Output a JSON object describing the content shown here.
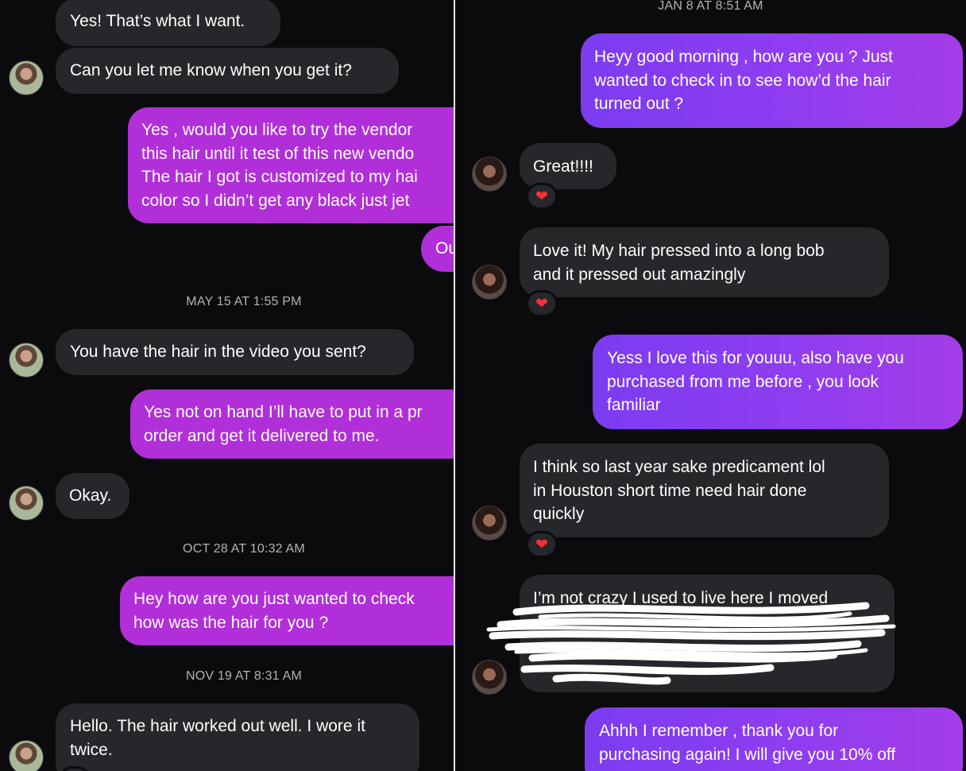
{
  "left": {
    "timestamps": [
      "MAY 15 AT 1:55 PM",
      "OCT 28 AT 10:32 AM",
      "NOV 19 AT 8:31 AM"
    ],
    "messages": [
      {
        "lines": [
          "Yes! That’s what I want."
        ]
      },
      {
        "lines": [
          "Can you let me know when you get it?"
        ]
      },
      {
        "lines": [
          "Yes , would you like to try the vendor",
          "this hair until it test of this new vendo",
          "The hair I got is customized to my hai",
          "color so I didn’t get any black just jet"
        ]
      },
      {
        "lines": [
          "Ou"
        ]
      },
      {
        "lines": [
          "You have the hair in the video you sent?"
        ]
      },
      {
        "lines": [
          "Yes not on hand I’ll have to put in a pr",
          "order and get it delivered to me."
        ]
      },
      {
        "lines": [
          "Okay."
        ]
      },
      {
        "lines": [
          "Hey how are you just wanted to check",
          "how was the hair for you ?"
        ]
      },
      {
        "lines": [
          "Hello. The hair worked out well. I wore it",
          "twice."
        ]
      }
    ]
  },
  "right": {
    "timestamps": [
      "JAN 8 AT 8:51 AM"
    ],
    "messages": [
      {
        "lines": [
          "Heyy good morning , how are you ? Just",
          "wanted to check in to see how’d  the hair",
          "turned out ?"
        ]
      },
      {
        "lines": [
          "Great!!!!"
        ]
      },
      {
        "lines": [
          "Love it! My hair pressed into a long bob",
          "and it pressed out amazingly"
        ]
      },
      {
        "lines": [
          "Yess I love this for youuu, also have you",
          "purchased from me before , you look",
          "familiar"
        ]
      },
      {
        "lines": [
          "I think so last year sake predicament lol",
          "in Houston short time need hair done",
          "quickly"
        ]
      },
      {
        "lines": [
          "I’m not crazy I used to live here I moved"
        ]
      },
      {
        "lines": [
          "Ahhh I remember , thank you for",
          "purchasing again!  I will give you 10% off"
        ]
      }
    ]
  },
  "icons": {
    "reaction": "heart-reaction-icon",
    "avatar": "contact-avatar"
  },
  "colors": {
    "incoming": "#26272b",
    "outgoing_left": "#b12fd8",
    "outgoing_right": "#8a3cf0",
    "reaction": "#ff2d3a",
    "background": "#0b0b0d"
  }
}
